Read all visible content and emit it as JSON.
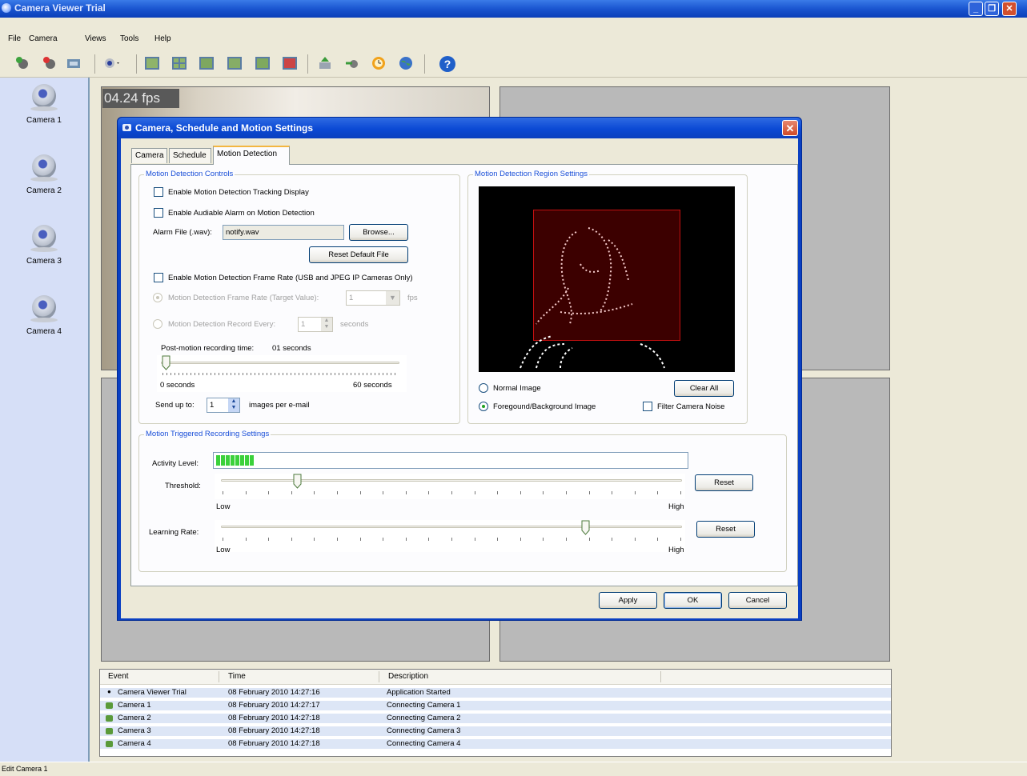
{
  "app": {
    "title": "Camera Viewer Trial",
    "menu": [
      "File",
      "Camera",
      "Views",
      "Tools",
      "Help"
    ],
    "status": "Edit Camera 1"
  },
  "cameras": [
    {
      "label": "Camera 1"
    },
    {
      "label": "Camera 2"
    },
    {
      "label": "Camera 3"
    },
    {
      "label": "Camera 4"
    }
  ],
  "feed": {
    "fps": "04.24 fps"
  },
  "dialog": {
    "title": "Camera, Schedule and Motion Settings",
    "tabs": [
      "Camera",
      "Schedule",
      "Motion Detection"
    ],
    "active_tab": "Motion Detection",
    "controls": {
      "group_label": "Motion Detection Controls",
      "tracking_display": {
        "label": "Enable Motion Detection Tracking Display",
        "checked": false
      },
      "audible_alarm": {
        "label": "Enable Audiable Alarm on Motion Detection",
        "checked": false
      },
      "alarm_file_label": "Alarm File (.wav):",
      "alarm_file_value": "notify.wav",
      "browse_label": "Browse...",
      "reset_default_label": "Reset Default File",
      "frame_rate_enable": {
        "label": "Enable Motion Detection Frame Rate (USB and JPEG IP Cameras Only)",
        "checked": false
      },
      "frame_rate_radio": {
        "label": "Motion Detection Frame Rate (Target Value):",
        "value": "1",
        "unit": "fps",
        "selected": true
      },
      "record_every_radio": {
        "label": "Motion Detection Record Every:",
        "value": "1",
        "unit": "seconds",
        "selected": false
      },
      "post_motion_label": "Post-motion recording time:",
      "post_motion_value": "01 seconds",
      "post_motion_fraction": 0.02,
      "post_min": "0 seconds",
      "post_max": "60 seconds",
      "send_up_to_label": "Send up to:",
      "send_up_to_value": "1",
      "images_per_email": "images per e-mail"
    },
    "region": {
      "group_label": "Motion Detection Region Settings",
      "normal_image": {
        "label": "Normal Image",
        "selected": false
      },
      "fg_bg_image": {
        "label": "Foregound/Background Image",
        "selected": true
      },
      "clear_all": "Clear All",
      "filter_noise": {
        "label": "Filter Camera Noise",
        "checked": false
      }
    },
    "recording": {
      "group_label": "Motion Triggered Recording Settings",
      "activity_label": "Activity Level:",
      "activity_fraction": 0.08,
      "threshold_label": "Threshold:",
      "threshold_fraction": 0.165,
      "learning_label": "Learning Rate:",
      "learning_fraction": 0.79,
      "low": "Low",
      "high": "High",
      "reset": "Reset"
    },
    "buttons": {
      "apply": "Apply",
      "ok": "OK",
      "cancel": "Cancel"
    }
  },
  "events": {
    "columns": [
      "Event",
      "Time",
      "Description"
    ],
    "rows": [
      {
        "event": "Camera Viewer Trial",
        "time": "08 February 2010 14:27:16",
        "description": "Application Started"
      },
      {
        "event": "Camera 1",
        "time": "08 February 2010 14:27:17",
        "description": "Connecting Camera 1"
      },
      {
        "event": "Camera 2",
        "time": "08 February 2010 14:27:18",
        "description": "Connecting Camera 2"
      },
      {
        "event": "Camera 3",
        "time": "08 February 2010 14:27:18",
        "description": "Connecting Camera 3"
      },
      {
        "event": "Camera 4",
        "time": "08 February 2010 14:27:18",
        "description": "Connecting Camera 4"
      }
    ]
  },
  "colors": {
    "accent": "#0a3fc2",
    "region_rect": "#c31010",
    "activity": "#3bd13b"
  }
}
